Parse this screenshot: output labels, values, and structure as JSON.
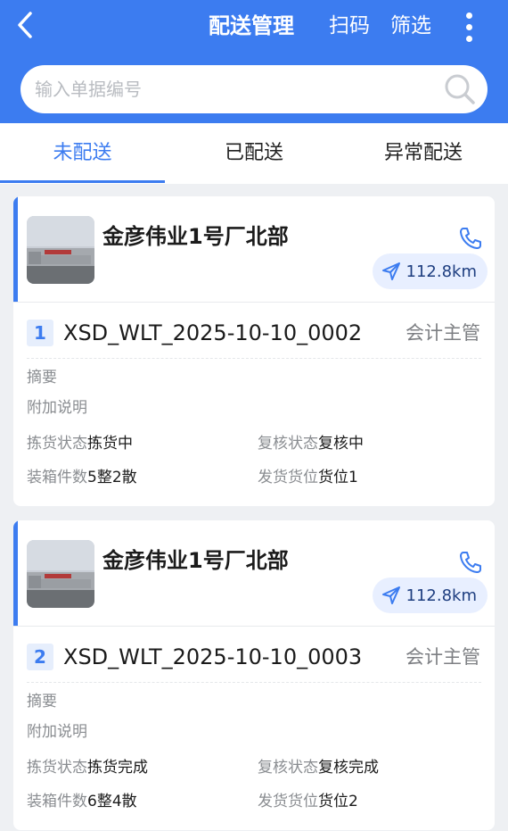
{
  "header": {
    "title": "配送管理",
    "scan_label": "扫码",
    "filter_label": "筛选"
  },
  "search": {
    "placeholder": "输入单据编号"
  },
  "tabs": [
    {
      "label": "未配送",
      "active": true
    },
    {
      "label": "已配送",
      "active": false
    },
    {
      "label": "异常配送",
      "active": false
    }
  ],
  "orders": [
    {
      "index": "1",
      "shop_name": "金彦伟业1号厂北部",
      "distance": "112.8km",
      "order_no": "XSD_WLT_2025-10-10_0002",
      "role": "会计主管",
      "summary_label": "摘要",
      "note_label": "附加说明",
      "pick_status_label": "拣货状态",
      "pick_status": "拣货中",
      "review_status_label": "复核状态",
      "review_status": "复核中",
      "box_count_label": "装箱件数",
      "box_count": "5整2散",
      "ship_slot_label": "发货货位",
      "ship_slot": "货位1"
    },
    {
      "index": "2",
      "shop_name": "金彦伟业1号厂北部",
      "distance": "112.8km",
      "order_no": "XSD_WLT_2025-10-10_0003",
      "role": "会计主管",
      "summary_label": "摘要",
      "note_label": "附加说明",
      "pick_status_label": "拣货状态",
      "pick_status": "拣货完成",
      "review_status_label": "复核状态",
      "review_status": "复核完成",
      "box_count_label": "装箱件数",
      "box_count": "6整4散",
      "ship_slot_label": "发货货位",
      "ship_slot": "货位2"
    }
  ],
  "colors": {
    "primary": "#3c7cf0",
    "background": "#eef0f3",
    "chip": "#e8efff"
  }
}
